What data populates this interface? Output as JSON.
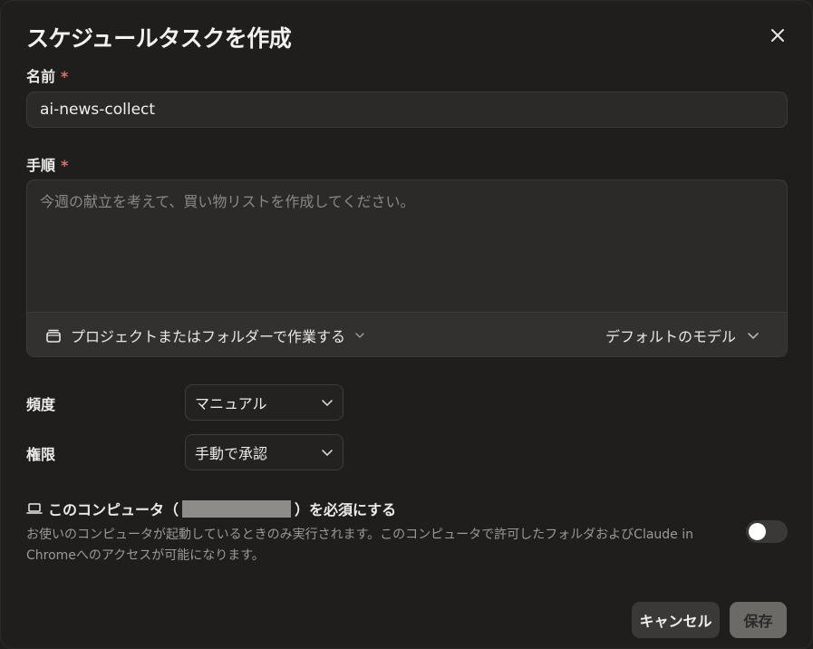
{
  "dialog": {
    "title": "スケジュールタスクを作成",
    "close_icon": "close-icon"
  },
  "name": {
    "label": "名前",
    "required_mark": "*",
    "value": "ai-news-collect"
  },
  "steps": {
    "label": "手順",
    "required_mark": "*",
    "placeholder": "今週の献立を考えて、買い物リストを作成してください。",
    "project_button": "プロジェクトまたはフォルダーで作業する",
    "project_icon": "folder-icon",
    "model_button": "デフォルトのモデル"
  },
  "frequency": {
    "label": "頻度",
    "selected": "マニュアル"
  },
  "permission": {
    "label": "権限",
    "selected": "手動で承認"
  },
  "computer": {
    "icon": "laptop-icon",
    "prefix": "このコンピュータ（",
    "suffix": "）を必須にする",
    "description": "お使いのコンピュータが起動しているときのみ実行されます。このコンピュータで許可したフォルダおよびClaude in Chromeへのアクセスが可能になります。",
    "toggle_on": false
  },
  "footer": {
    "cancel_label": "キャンセル",
    "save_label": "保存"
  },
  "colors": {
    "background": "#1f1e1d",
    "required": "#d4756a",
    "save_button": "#6b6a67"
  }
}
